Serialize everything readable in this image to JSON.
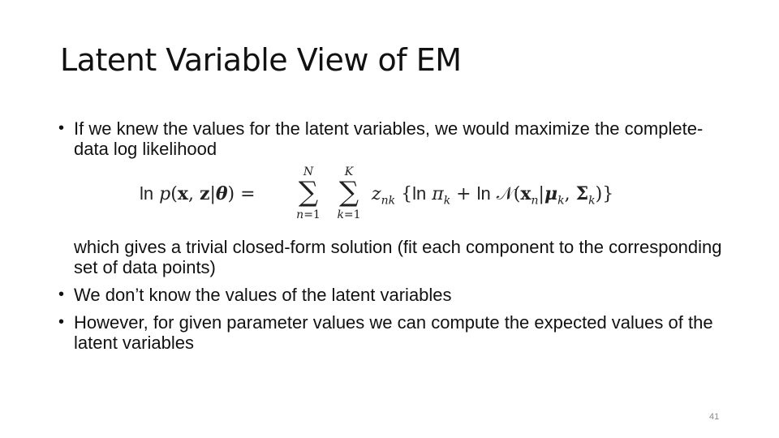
{
  "slide": {
    "title": "Latent Variable View of EM",
    "bullets": [
      {
        "marker": "•",
        "text": "If we knew the values for the latent variables, we would maximize the complete-data log likelihood"
      },
      {
        "marker": "•",
        "text": "We don’t know the values of the latent variables"
      },
      {
        "marker": "•",
        "text": "However, for given parameter values we can compute the expected values of the latent variables"
      }
    ],
    "continuation": "which gives a trivial closed-form solution (fit each component to the corresponding set of data points)",
    "equation": {
      "ln": "ln",
      "p": "p",
      "open": "(",
      "x": "x",
      "comma": ", ",
      "z": "z",
      "bar": "|",
      "theta": "θ",
      "close": ")",
      "equals": " = ",
      "sum1": {
        "upper": "N",
        "symbol": "∑",
        "lower_var": "n",
        "lower_rest": "=1"
      },
      "sum2": {
        "upper": "K",
        "symbol": "∑",
        "lower_var": "k",
        "lower_rest": "=1"
      },
      "z_nk": "z",
      "z_sub": "nk",
      "brace_open": " {",
      "pi": "π",
      "pi_sub": "k",
      "plus": " + ",
      "normal": "𝒩",
      "x_sub": "n",
      "mu": "μ",
      "mu_sub": "k",
      "sigma_cap": "Σ",
      "sigma_sub": "k",
      "end": ")}"
    },
    "page_number": "41"
  }
}
